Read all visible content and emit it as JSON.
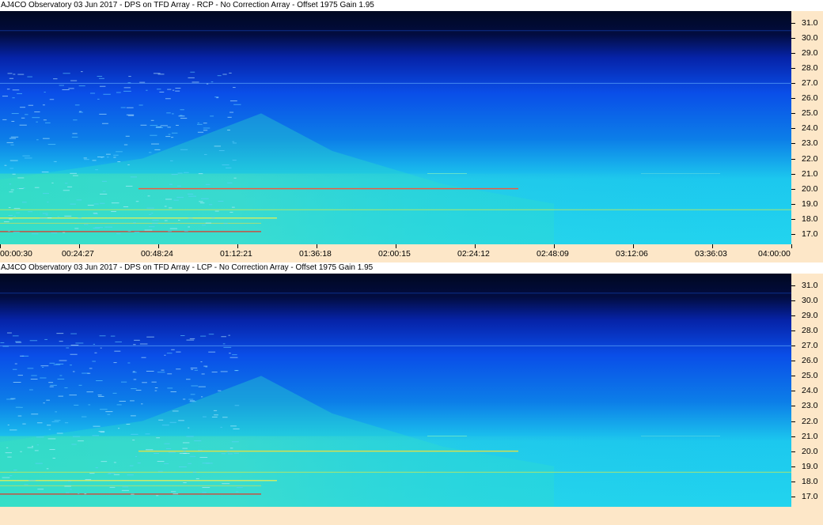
{
  "panels": [
    {
      "title": "AJ4CO Observatory 03 Jun 2017 - DPS on TFD Array  - RCP  -  No Correction Array  -  Offset 1975  Gain 1.95",
      "polarization": "RCP"
    },
    {
      "title": "AJ4CO Observatory 03 Jun 2017 - DPS on TFD Array  - LCP  -  No Correction Array  -  Offset 1975  Gain 1.95",
      "polarization": "LCP"
    }
  ],
  "frequency_axis": {
    "labels": [
      "31.0",
      "30.0",
      "29.0",
      "28.0",
      "27.0",
      "26.0",
      "25.0",
      "24.0",
      "23.0",
      "22.0",
      "21.0",
      "20.0",
      "19.0",
      "18.0",
      "17.0"
    ],
    "range": [
      16.3,
      31.8
    ]
  },
  "time_axis": {
    "labels": [
      "00:00:30",
      "00:24:27",
      "00:48:24",
      "01:12:21",
      "01:36:18",
      "02:00:15",
      "02:24:12",
      "02:48:09",
      "03:12:06",
      "03:36:03",
      "04:00:00"
    ]
  },
  "colors": {
    "background_dark": "#000820",
    "mid_blue": "#0a4ee8",
    "cyan": "#1cc8ee",
    "green": "#48e8a8",
    "axis_bg": "#fde7c8"
  }
}
